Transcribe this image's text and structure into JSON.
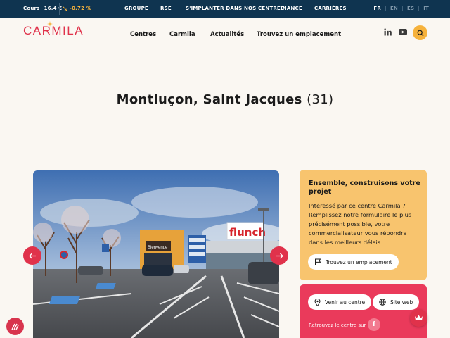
{
  "topbar": {
    "stock_label": "Cours",
    "stock_price": "16.4 €",
    "stock_change": "-0.72 %",
    "nav": [
      "GROUPE",
      "RSE",
      "S'IMPLANTER DANS NOS CENTRES",
      "FINANCE",
      "CARRIÈRES"
    ],
    "languages": [
      "FR",
      "EN",
      "ES",
      "IT"
    ],
    "active_language": "FR"
  },
  "header": {
    "logo": "CARMILA",
    "nav": [
      "Centres",
      "Carmila",
      "Actualités",
      "Trouvez un emplacement"
    ],
    "social": [
      "linkedin-icon",
      "youtube-icon"
    ]
  },
  "page": {
    "title": "Montluçon, Saint Jacques",
    "count": "(31)"
  },
  "hero": {
    "store_sign": "flunch",
    "entrance_sign": "Bienvenue"
  },
  "cta_card": {
    "title": "Ensemble, construisons votre projet",
    "text": "Intéressé par ce centre Carmila ? Remplissez notre formulaire le plus précisément possible, votre commercialisateur vous répondra dans les meilleurs délais.",
    "button": "Trouvez un emplacement"
  },
  "links_card": {
    "directions_button": "Venir au centre",
    "website_button": "Site web",
    "follow_text": "Retrouvez le centre sur",
    "social": "facebook-icon"
  },
  "colors": {
    "topbar": "#0f3450",
    "brand_red": "#e0324b",
    "accent_yellow": "#f6b23c",
    "card_yellow": "#f8c46e",
    "card_red": "#ea3a5b",
    "background": "#faf7f2"
  }
}
